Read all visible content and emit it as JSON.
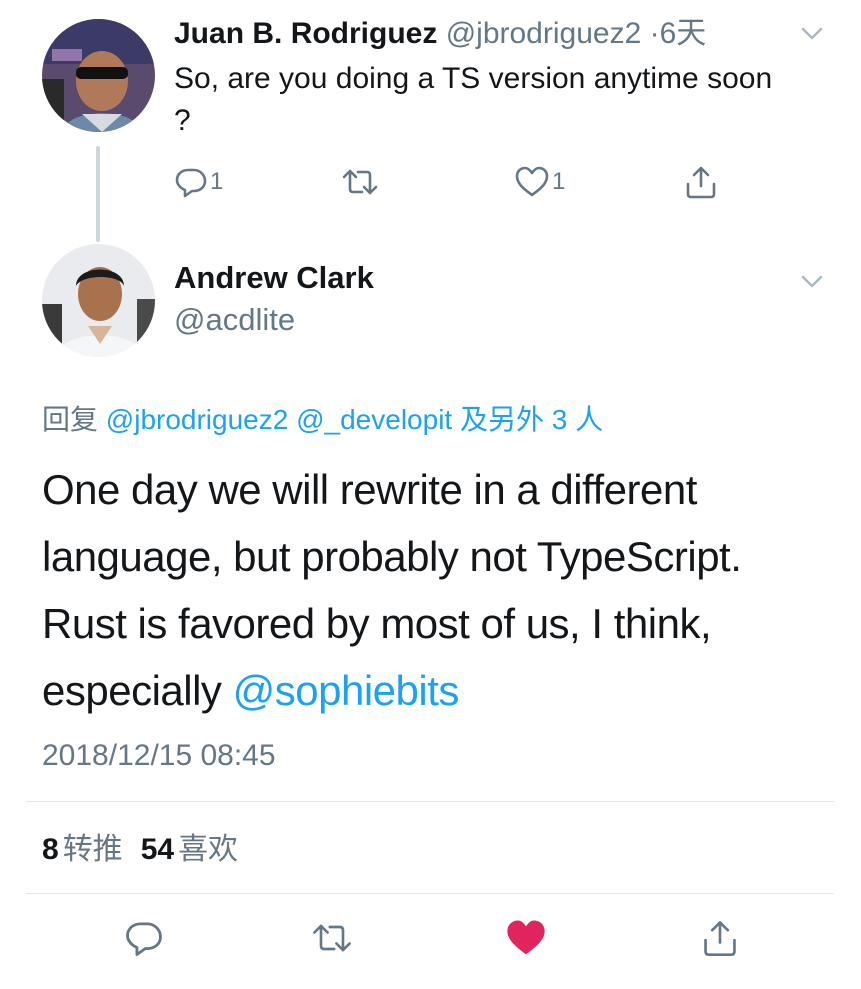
{
  "reply_tweet": {
    "author_name": "Juan B. Rodriguez",
    "author_handle": "@jbrodriguez2",
    "separator": "·",
    "age": "6天",
    "text": "So, are you doing a TS version anytime soon ?",
    "reply_count": "1",
    "like_count": "1"
  },
  "main_tweet": {
    "author_name": "Andrew Clark",
    "author_handle": "@acdlite",
    "replying_prefix": "回复",
    "replying_mention_1": "@jbrodriguez2",
    "replying_mention_2": "@_developit",
    "replying_suffix": "及另外 3 人",
    "text_body": "One day we will rewrite in a different language, but probably not TypeScript. Rust is favored by most of us, I think, especially ",
    "text_mention": "@sophiebits",
    "timestamp": "2018/12/15 08:45",
    "retweet_count": "8",
    "retweet_label": "转推",
    "like_count": "54",
    "like_label": "喜欢"
  },
  "colors": {
    "link": "#1da1f2",
    "secondary_text": "#657786",
    "like_active": "#e0245e",
    "icon": "#657786"
  },
  "icons": {
    "reply": "reply-icon",
    "retweet": "retweet-icon",
    "like": "heart-icon",
    "share": "share-icon",
    "menu": "chevron-down-icon"
  }
}
